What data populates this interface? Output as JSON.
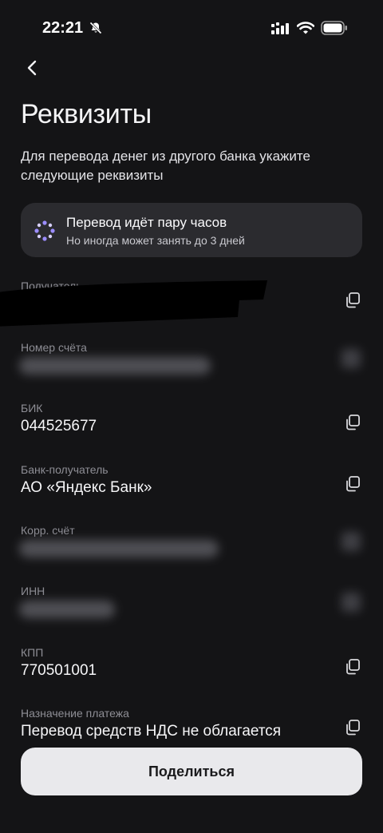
{
  "status_bar": {
    "time": "22:21",
    "icons": [
      "bell-muted-icon",
      "cellular-signal-icon",
      "wifi-icon",
      "battery-icon"
    ]
  },
  "nav": {
    "back_icon": "chevron-left-icon"
  },
  "header": {
    "title": "Реквизиты",
    "subtitle": "Для перевода денег из другого банка укажите следующие реквизиты"
  },
  "info_card": {
    "icon": "sparkle-icon",
    "title": "Перевод идёт пару часов",
    "text": "Но иногда может занять до 3 дней"
  },
  "fields": {
    "recipient": {
      "label": "Получатель"
    },
    "account": {
      "label": "Номер счёта"
    },
    "bik": {
      "label": "БИК",
      "value": "044525677"
    },
    "bank": {
      "label": "Банк-получатель",
      "value": "АО «Яндекс Банк»"
    },
    "corr_account": {
      "label": "Корр. счёт"
    },
    "inn": {
      "label": "ИНН"
    },
    "kpp": {
      "label": "КПП",
      "value": "770501001"
    },
    "purpose": {
      "label": "Назначение платежа",
      "value": "Перевод средств НДС не облагается"
    }
  },
  "share_button": {
    "label": "Поделиться"
  },
  "colors": {
    "background": "#141416",
    "card": "#2b2b2f",
    "label": "#8e8e95",
    "button": "#e9e9ec",
    "accent_sparkle": "#9b8cff"
  }
}
